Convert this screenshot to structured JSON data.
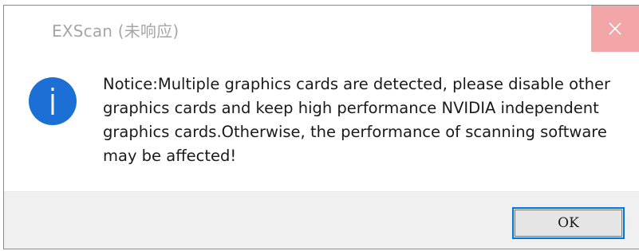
{
  "window": {
    "title": "EXScan (未响应)"
  },
  "titlebar": {
    "close_icon": "close-icon",
    "close_hover_color": "#f2a6a7"
  },
  "dialog": {
    "icon": "info-icon",
    "icon_color": "#1c6fd4",
    "message": "Notice:Multiple graphics cards are detected, please disable other graphics cards and keep high performance NVIDIA independent graphics cards.Otherwise, the performance of scanning software may be affected!"
  },
  "footer": {
    "ok_label": "OK",
    "focus_color": "#0078d7"
  }
}
